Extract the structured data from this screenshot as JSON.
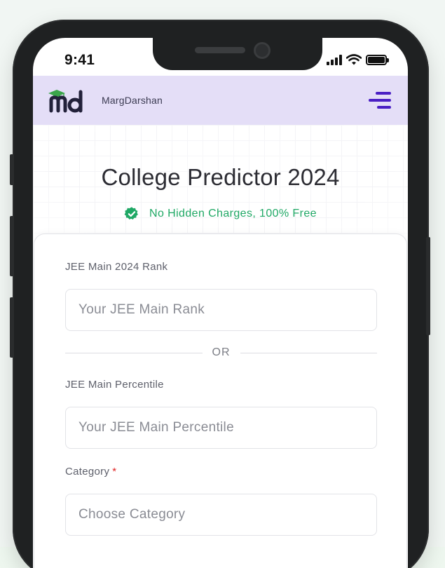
{
  "status_bar": {
    "time": "9:41"
  },
  "header": {
    "brand": "MargDarshan",
    "logo_letters": "md",
    "menu_icon": "hamburger-menu-icon"
  },
  "hero": {
    "title": "College Predictor 2024",
    "subtitle": "No Hidden Charges, 100% Free",
    "badge_icon": "verified-check-icon"
  },
  "form": {
    "rank_label": "JEE Main 2024 Rank",
    "rank_placeholder": "Your JEE Main Rank",
    "or_text": "OR",
    "percentile_label": "JEE Main Percentile",
    "percentile_placeholder": "Your JEE Main Percentile",
    "category_label": "Category",
    "category_required": "*",
    "category_placeholder": "Choose Category"
  },
  "colors": {
    "header_bg": "#e4def7",
    "accent_purple": "#4a1fc4",
    "success_green": "#1fa865",
    "logo_green": "#3aa54a",
    "required_red": "#e02424"
  }
}
